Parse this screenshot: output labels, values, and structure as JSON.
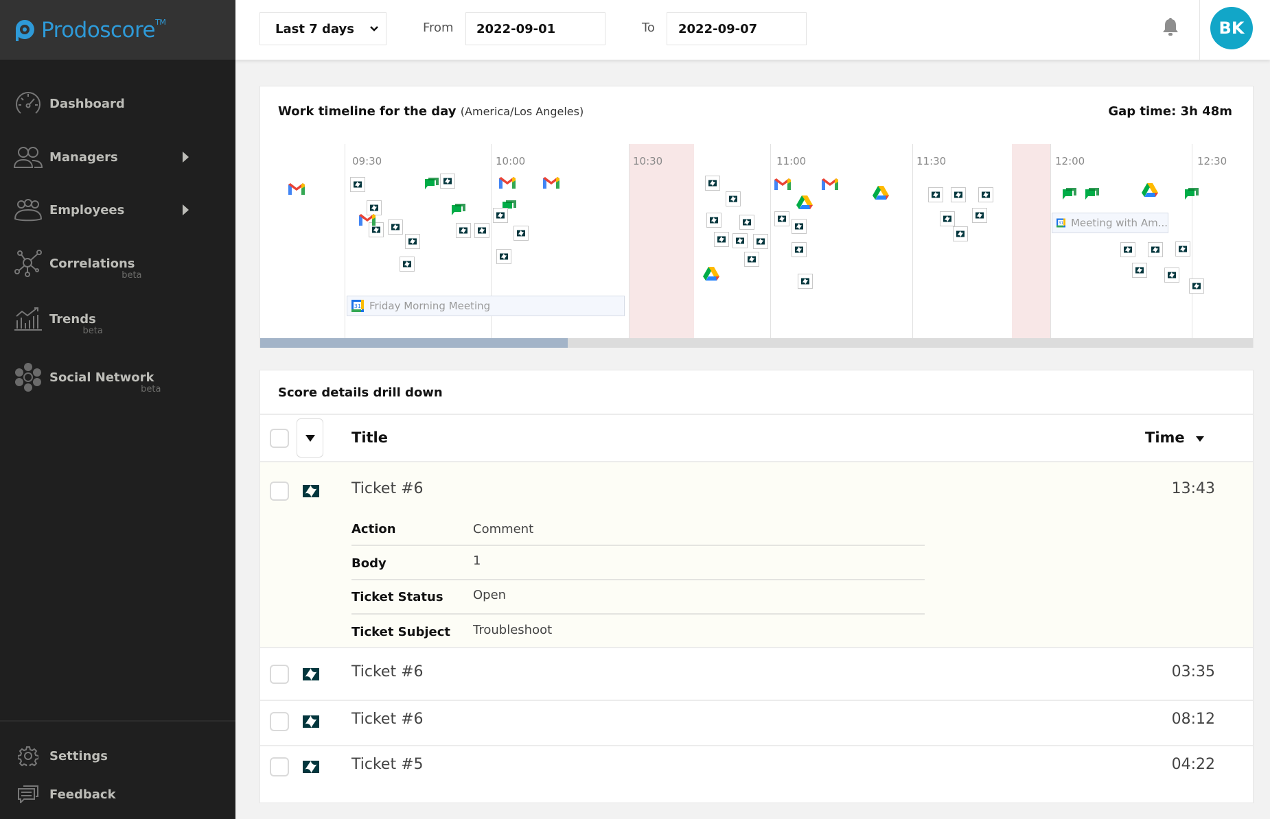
{
  "app": {
    "name": "Prodoscore",
    "trademark": "TM",
    "brand_color": "#2e9ad8"
  },
  "sidebar": {
    "items": [
      {
        "label": "Dashboard",
        "icon": "speedometer-icon",
        "beta": null,
        "has_submenu": false
      },
      {
        "label": "Managers",
        "icon": "managers-icon",
        "beta": null,
        "has_submenu": true
      },
      {
        "label": "Employees",
        "icon": "employees-icon",
        "beta": null,
        "has_submenu": true
      },
      {
        "label": "Correlations",
        "icon": "correlations-icon",
        "beta": "beta",
        "has_submenu": false
      },
      {
        "label": "Trends",
        "icon": "trends-icon",
        "beta": "beta",
        "has_submenu": false
      },
      {
        "label": "Social Network",
        "icon": "social-network-icon",
        "beta": "beta",
        "has_submenu": false
      }
    ],
    "bottom_items": [
      {
        "label": "Settings",
        "icon": "gear-icon"
      },
      {
        "label": "Feedback",
        "icon": "feedback-icon"
      }
    ]
  },
  "header": {
    "range_select": "Last 7 days",
    "from_label": "From",
    "from_value": "2022-09-01",
    "to_label": "To",
    "to_value": "2022-09-07",
    "avatar_initials": "BK",
    "avatar_color": "#12a6c8"
  },
  "timeline": {
    "title": "Work timeline for the day",
    "timezone": "(America/Los Angeles)",
    "gap_time": "Gap time: 3h 48m",
    "ticks": [
      "09:30",
      "10:00",
      "10:30",
      "11:00",
      "11:30",
      "12:00",
      "12:30"
    ],
    "meetings": [
      "Friday Morning Meeting",
      "Meeting with Am..."
    ],
    "scroll_fraction": 0.31,
    "event_types": [
      "gmail",
      "zendesk",
      "google-chat",
      "google-drive",
      "google-calendar"
    ]
  },
  "drilldown": {
    "title": "Score details drill down",
    "columns": {
      "title": "Title",
      "time": "Time"
    },
    "rows": [
      {
        "title": "Ticket #6",
        "time": "13:43",
        "source": "zendesk",
        "expanded": true,
        "details": [
          {
            "key": "Action",
            "value": "Comment"
          },
          {
            "key": "Body",
            "value": "1"
          },
          {
            "key": "Ticket Status",
            "value": "Open"
          },
          {
            "key": "Ticket Subject",
            "value": "Troubleshoot"
          }
        ]
      },
      {
        "title": "Ticket #6",
        "time": "03:35",
        "source": "zendesk",
        "expanded": false
      },
      {
        "title": "Ticket #6",
        "time": "08:12",
        "source": "zendesk",
        "expanded": false
      },
      {
        "title": "Ticket #5",
        "time": "04:22",
        "source": "zendesk",
        "expanded": false
      }
    ]
  }
}
